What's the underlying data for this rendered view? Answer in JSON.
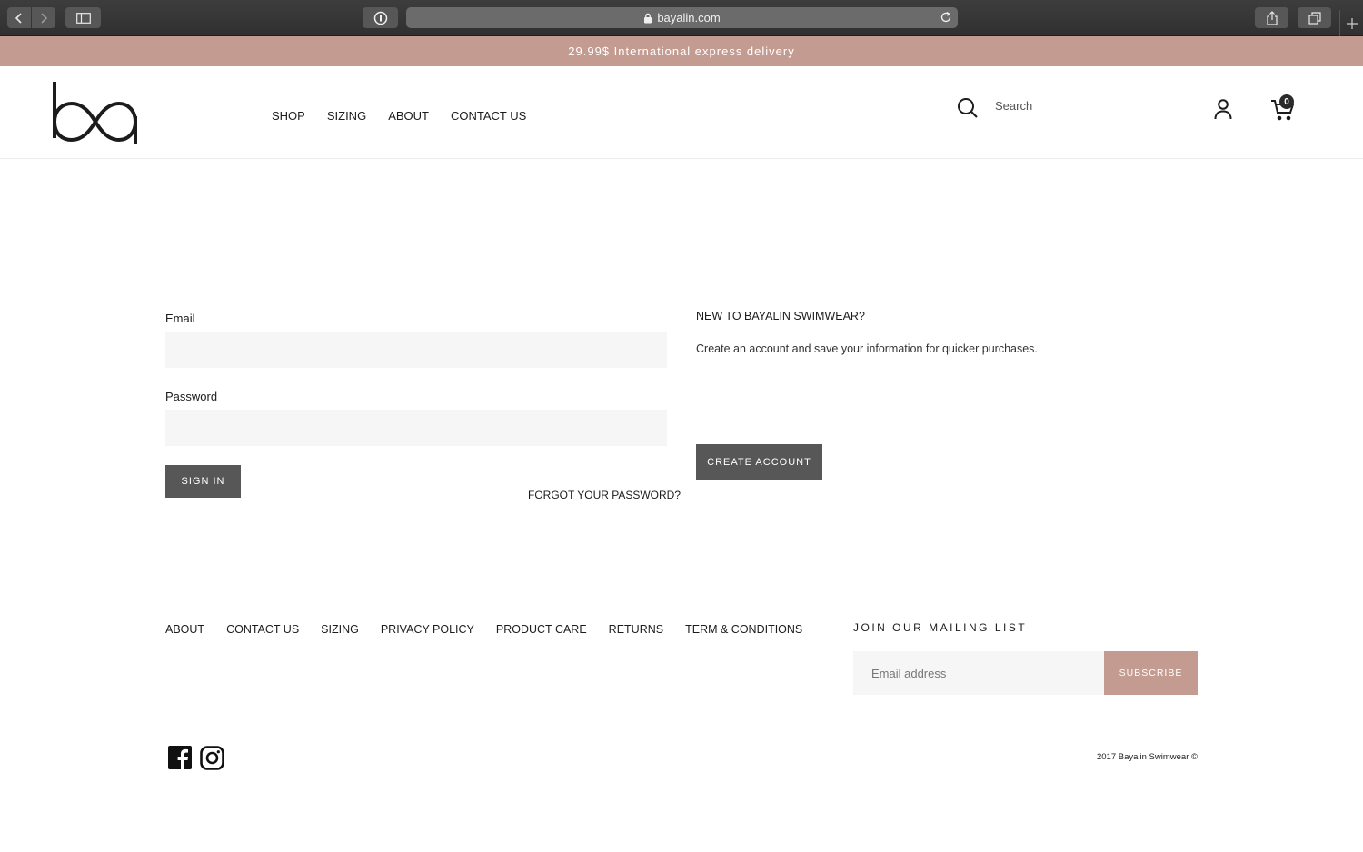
{
  "browser": {
    "url": "bayalin.com"
  },
  "announcement": "29.99$ International express delivery",
  "header": {
    "nav": [
      "SHOP",
      "SIZING",
      "ABOUT",
      "CONTACT US"
    ],
    "search_placeholder": "Search",
    "cart_count": "0"
  },
  "login": {
    "email_label": "Email",
    "password_label": "Password",
    "sign_in_label": "SIGN IN",
    "forgot_label": "FORGOT YOUR PASSWORD?"
  },
  "register": {
    "title": "NEW TO BAYALIN SWIMWEAR?",
    "text": "Create an account and save your information for quicker purchases.",
    "button_label": "CREATE ACCOUNT"
  },
  "footer": {
    "links": [
      "ABOUT",
      "CONTACT US",
      "SIZING",
      "PRIVACY POLICY",
      "PRODUCT CARE",
      "RETURNS",
      "TERM & CONDITIONS"
    ],
    "mailing_title": "JOIN OUR MAILING LIST",
    "email_placeholder": "Email address",
    "subscribe_label": "SUBSCRIBE",
    "copyright": "2017 Bayalin Swimwear ©"
  },
  "colors": {
    "accent": "#c49b91",
    "button_dark": "#575757",
    "field_bg": "#f6f6f6"
  }
}
